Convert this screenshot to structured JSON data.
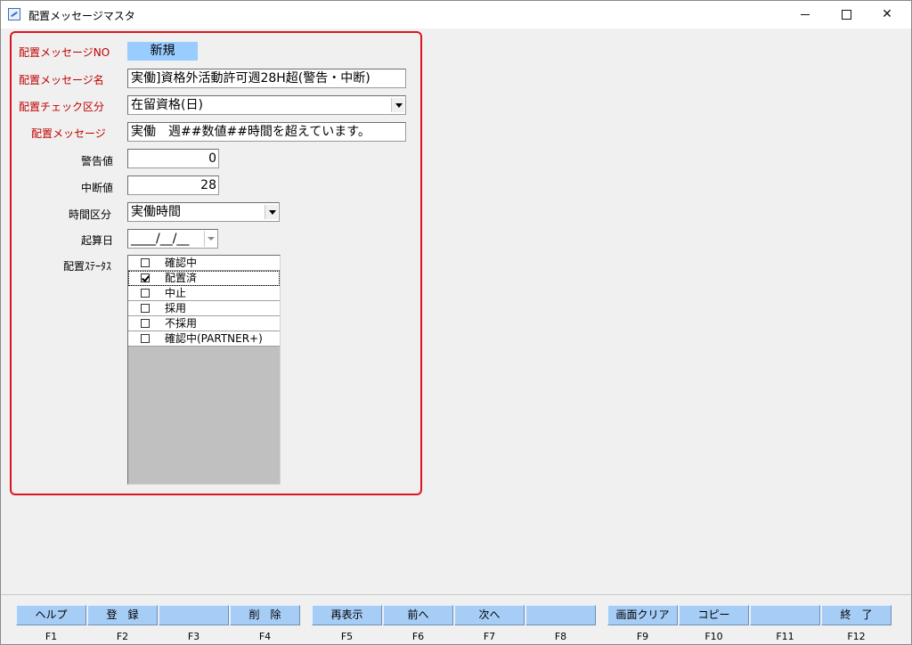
{
  "window": {
    "title": "配置メッセージマスタ",
    "app_icon": "app-form-icon"
  },
  "form": {
    "message_no": {
      "label": "配置メッセージNO",
      "value": "新規"
    },
    "message_name": {
      "label": "配置メッセージ名",
      "value": "実働]資格外活動許可週28H超(警告・中断)"
    },
    "check_category": {
      "label": "配置チェック区分",
      "value": "在留資格(日)"
    },
    "message": {
      "label": "配置メッセージ",
      "value": "実働　週##数値##時間を超えています。"
    },
    "warning_value": {
      "label": "警告値",
      "value": "0"
    },
    "stop_value": {
      "label": "中断値",
      "value": "28"
    },
    "time_category": {
      "label": "時間区分",
      "value": "実働時間"
    },
    "start_date": {
      "label": "起算日",
      "value": "____/__/__"
    },
    "status": {
      "label": "配置ｽﾃｰﾀｽ",
      "items": [
        {
          "label": "確認中",
          "checked": false
        },
        {
          "label": "配置済",
          "checked": true
        },
        {
          "label": "中止",
          "checked": false
        },
        {
          "label": "採用",
          "checked": false
        },
        {
          "label": "不採用",
          "checked": false
        },
        {
          "label": "確認中(PARTNER+)",
          "checked": false
        }
      ]
    }
  },
  "fkeys": [
    {
      "label": "ヘルプ",
      "key": "F1"
    },
    {
      "label": "登　録",
      "key": "F2"
    },
    {
      "label": "",
      "key": "F3"
    },
    {
      "label": "削　除",
      "key": "F4"
    },
    {
      "label": "再表示",
      "key": "F5"
    },
    {
      "label": "前へ",
      "key": "F6"
    },
    {
      "label": "次へ",
      "key": "F7"
    },
    {
      "label": "",
      "key": "F8"
    },
    {
      "label": "画面クリア",
      "key": "F9"
    },
    {
      "label": "コピー",
      "key": "F10"
    },
    {
      "label": "",
      "key": "F11"
    },
    {
      "label": "終　了",
      "key": "F12"
    }
  ],
  "colors": {
    "required_label": "#c00000",
    "frame_border": "#e0141e",
    "fkey_button": "#a6cdf6",
    "new_badge": "#99ccff"
  }
}
